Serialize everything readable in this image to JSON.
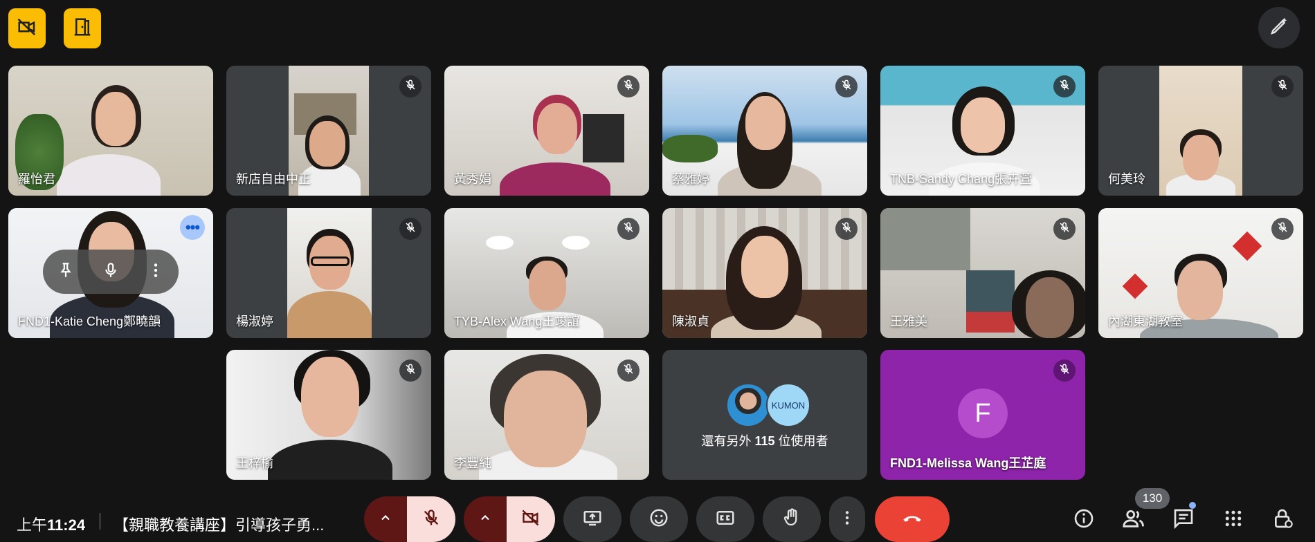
{
  "meeting": {
    "time_prefix": "上午",
    "time": "11:24",
    "title": "【親職教養講座】引導孩子勇...",
    "participant_count": "130"
  },
  "participants": [
    {
      "name": "羅怡君",
      "muted": false
    },
    {
      "name": "新店自由中正",
      "muted": true
    },
    {
      "name": "黃秀娟",
      "muted": true
    },
    {
      "name": "蔡雅婷",
      "muted": true
    },
    {
      "name": "TNB-Sandy Chang張卉萱",
      "muted": true
    },
    {
      "name": "何美玲",
      "muted": true
    },
    {
      "name": "FND1-Katie Cheng鄭曉韻",
      "muted": false,
      "active": true
    },
    {
      "name": "楊淑婷",
      "muted": true
    },
    {
      "name": "TYB-Alex Wang王竣誼",
      "muted": true
    },
    {
      "name": "陳淑貞",
      "muted": true
    },
    {
      "name": "王雅美",
      "muted": true
    },
    {
      "name": "內湖東湖教室",
      "muted": true
    },
    {
      "name": "王梓榆",
      "muted": true
    },
    {
      "name": "李豐純",
      "muted": true
    },
    {
      "name": "FND1-Melissa Wang王芷庭",
      "muted": true,
      "initial": "F"
    }
  ],
  "others": {
    "label_prefix": "還有另外",
    "count": "115",
    "label_suffix": "位使用者",
    "avatar_text": "KUMON"
  },
  "icons": {
    "top_left": [
      "video-off-icon",
      "door-icon"
    ],
    "top_right": "pencil-sparkle-icon",
    "controls": [
      "chevron-up-icon",
      "mic-off-icon",
      "chevron-up-icon",
      "camera-off-icon",
      "present-icon",
      "emoji-icon",
      "captions-icon",
      "raise-hand-icon",
      "more-vert-icon",
      "hang-up-icon"
    ],
    "right": [
      "info-icon",
      "people-icon",
      "chat-icon",
      "apps-icon",
      "host-controls-icon"
    ]
  },
  "colors": {
    "accent_yellow": "#fbbc04",
    "hangup_red": "#ea4335",
    "active_outline": "#a8c7fa",
    "melissa_tile": "#8e24aa"
  }
}
